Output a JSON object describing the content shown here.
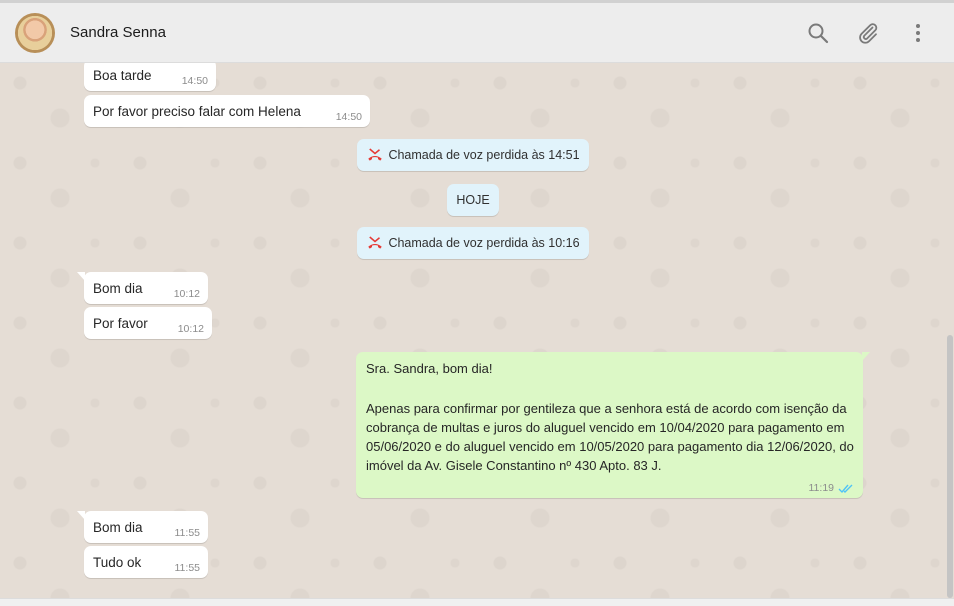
{
  "contact": {
    "name": "Sandra Senna"
  },
  "icons": {
    "search": "search-icon",
    "attach": "paperclip-icon",
    "menu": "kebab-menu-icon",
    "missed_call": "missed-call-icon",
    "read": "double-check-icon"
  },
  "colors": {
    "incoming_bg": "#ffffff",
    "outgoing_bg": "#dcf8c6",
    "system_bg": "#e1f3fb",
    "missed_call": "#e53935",
    "read_ticks": "#4fc3f7",
    "chat_bg": "#e5ddd5"
  },
  "messages": {
    "m1": {
      "text": "Boa tarde",
      "time": "14:50"
    },
    "m2": {
      "text": "Por favor preciso falar com Helena",
      "time": "14:50"
    },
    "sys1": {
      "text": "Chamada de voz perdida às 14:51"
    },
    "date_divider": {
      "text": "HOJE"
    },
    "sys2": {
      "text": "Chamada de voz perdida às 10:16"
    },
    "m3": {
      "text": "Bom dia",
      "time": "10:12"
    },
    "m4": {
      "text": "Por favor",
      "time": "10:12"
    },
    "out1": {
      "greeting": "Sra. Sandra, bom dia!",
      "body": "Apenas para confirmar por gentileza que a senhora está de acordo com isenção da cobrança de multas e juros do aluguel vencido em 10/04/2020 para pagamento em 05/06/2020 e do aluguel vencido em 10/05/2020 para pagamento dia 12/06/2020, do imóvel da Av. Gisele Constantino nº 430 Apto. 83 J.",
      "time": "11:19"
    },
    "m5": {
      "text": "Bom dia",
      "time": "11:55"
    },
    "m6": {
      "text": "Tudo ok",
      "time": "11:55"
    }
  }
}
